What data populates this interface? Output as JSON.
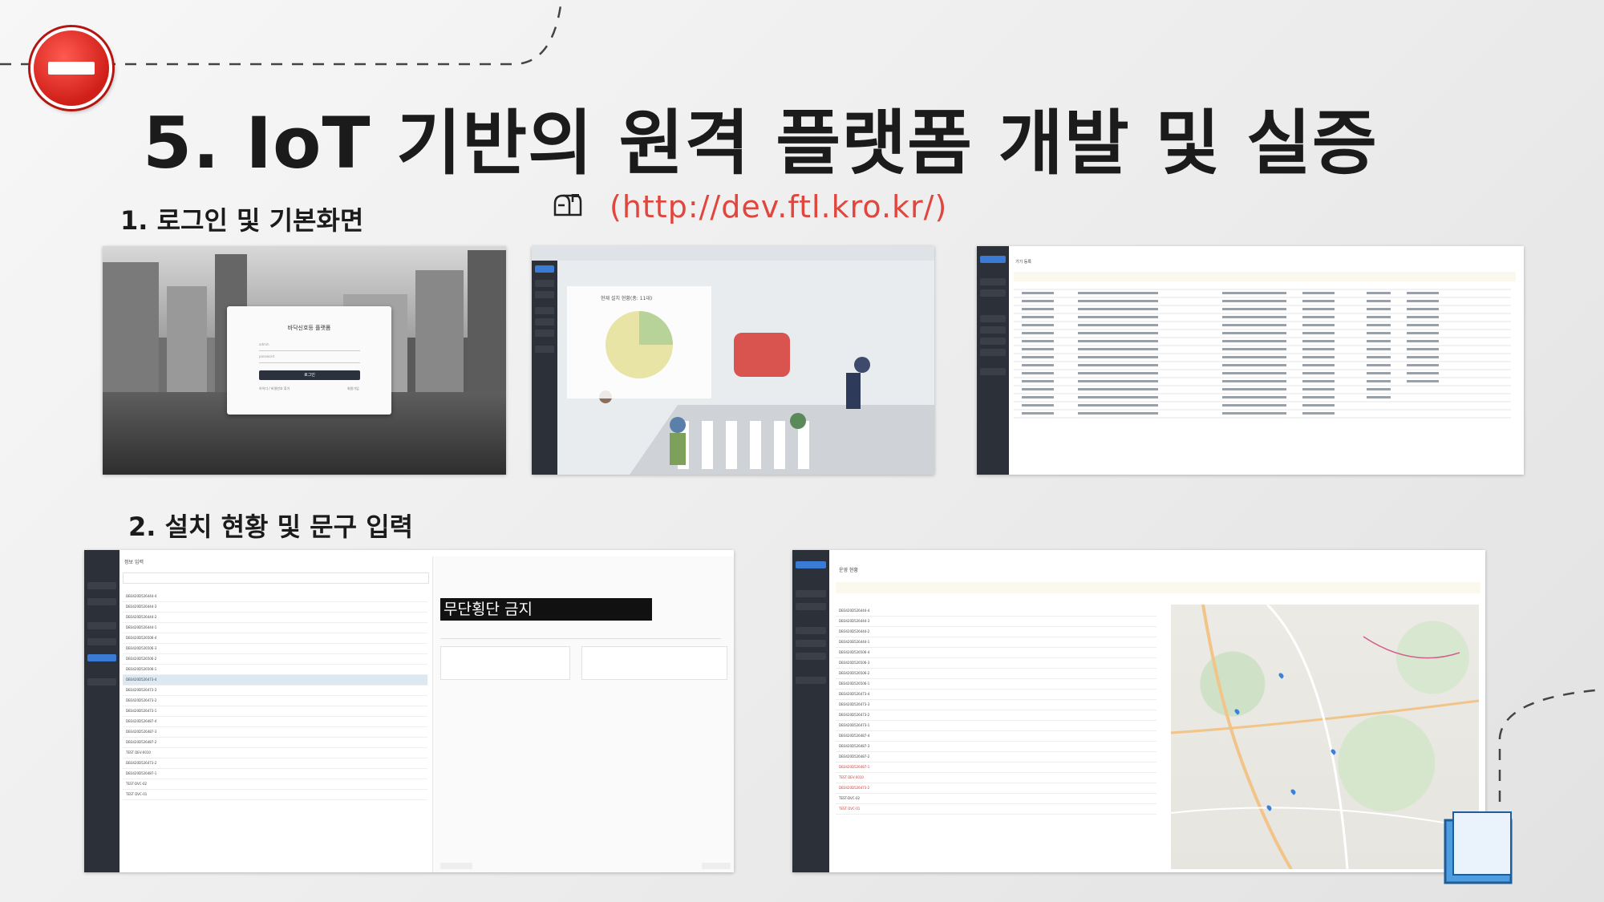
{
  "slide": {
    "title": "5. IoT 기반의 원격 플랫폼 개발 및 실증",
    "section1": "1. 로그인 및 기본화면",
    "section2": "2. 설치 현황 및 문구 입력",
    "url": "(http://dev.ftl.kro.kr/)",
    "accent_color": "#e0463d"
  },
  "login": {
    "title": "바닥신호등 플랫폼",
    "id_placeholder": "admin",
    "pw_placeholder": "password",
    "button": "로그인",
    "footer_left": "아이디 / 비밀번호 찾기",
    "footer_right": "회원가입"
  },
  "dashboard": {
    "pie_title": "현재 설치 현황(총: 11대)"
  },
  "device": {
    "header": "기기 등록",
    "sidebar": [
      "Home",
      "시스템 관리",
      "코드관리",
      "사용자관리",
      "기기 관리",
      "운영 현황",
      "기기 등록",
      "정보 입력",
      "환경 설정",
      "설치 현황"
    ]
  },
  "info_input": {
    "header": "정보 입력",
    "banner_text": "무단횡단 금지",
    "rows": [
      "DB3420D526444-4",
      "DB3420D526444-3",
      "DB3420D526444-2",
      "DB3420D526444-1",
      "DB3420D526506-4",
      "DB3420D526506-3",
      "DB3420D526506-2",
      "DB3420D526506-1",
      "DB3420D526473-4",
      "DB3420D526473-3",
      "DB3420D526473-2",
      "DB3420D526473-1",
      "DB3420D526487-4",
      "DB3420D526487-3",
      "DB3420D526487-2",
      "TEST DEV-0010",
      "DB3420D526473-2",
      "DB3420D526487-1",
      "TEST-DVC-02",
      "TEST DVC-01"
    ]
  },
  "operation": {
    "header": "운영 현황",
    "rows": [
      "DB3420D526444-4",
      "DB3420D526444-3",
      "DB3420D526444-2",
      "DB3420D526444-1",
      "DB3420D526506-4",
      "DB3420D526506-3",
      "DB3420D526506-2",
      "DB3420D526506-1",
      "DB3420D526473-4",
      "DB3420D526473-3",
      "DB3420D526473-2",
      "DB3420D526473-1",
      "DB3420D526487-4",
      "DB3420D526487-3",
      "DB3420D526487-2",
      "DB3420D526487-1",
      "TEST DEV-0010",
      "DB3420D526473-2",
      "TEST-DVC-02",
      "TEST DVC-01"
    ]
  }
}
